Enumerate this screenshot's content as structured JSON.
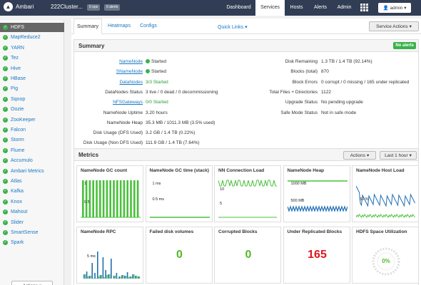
{
  "topbar": {
    "brand": "Ambari",
    "cluster": "222Cluster...",
    "ops_badge": "0 ops",
    "alerts_badge": "0 alerts",
    "nav": [
      "Dashboard",
      "Services",
      "Hosts",
      "Alerts",
      "Admin"
    ],
    "active_nav": "Services",
    "user": "admin"
  },
  "sidebar": {
    "items": [
      {
        "label": "HDFS",
        "selected": true
      },
      {
        "label": "MapReduce2"
      },
      {
        "label": "YARN"
      },
      {
        "label": "Tez"
      },
      {
        "label": "Hive"
      },
      {
        "label": "HBase"
      },
      {
        "label": "Pig"
      },
      {
        "label": "Sqoop"
      },
      {
        "label": "Oozie"
      },
      {
        "label": "ZooKeeper"
      },
      {
        "label": "Falcon"
      },
      {
        "label": "Storm"
      },
      {
        "label": "Flume"
      },
      {
        "label": "Accumulo"
      },
      {
        "label": "Ambari Metrics"
      },
      {
        "label": "Atlas"
      },
      {
        "label": "Kafka"
      },
      {
        "label": "Knox"
      },
      {
        "label": "Mahout"
      },
      {
        "label": "Slider"
      },
      {
        "label": "SmartSense"
      },
      {
        "label": "Spark"
      }
    ],
    "actions_label": "Actions"
  },
  "tabs": {
    "items": [
      "Summary",
      "Heatmaps",
      "Configs"
    ],
    "quick_links": "Quick Links",
    "service_actions": "Service Actions"
  },
  "summary": {
    "title": "Summary",
    "alert_badge": "No alerts",
    "left_rows": [
      {
        "label": "NameNode",
        "value": "Started",
        "link": true,
        "check": true
      },
      {
        "label": "SNameNode",
        "value": "Started",
        "link": true,
        "check": true
      },
      {
        "label": "DataNodes",
        "value": "3/3 Started",
        "link": true,
        "green": true
      },
      {
        "label": "DataNodes Status",
        "value": "3 live / 0 dead / 0 decommissioning"
      },
      {
        "label": "NFSGateways",
        "value": "0/0 Started",
        "link": true,
        "green": true
      },
      {
        "label": "NameNode Uptime",
        "value": "3.20 hours"
      },
      {
        "label": "NameNode Heap",
        "value": "35.3 MB / 1011.3 MB (3.5% used)"
      },
      {
        "label": "Disk Usage (DFS Used)",
        "value": "3.2 GB / 1.4 TB (0.22%)"
      },
      {
        "label": "Disk Usage (Non DFS Used)",
        "value": "111.9 GB / 1.4 TB (7.64%)"
      }
    ],
    "right_rows": [
      {
        "label": "Disk Remaining",
        "value": "1.3 TB / 1.4 TB (92.14%)"
      },
      {
        "label": "Blocks (total)",
        "value": "870"
      },
      {
        "label": "Block Errors",
        "value": "0 corrupt / 0 missing / 165 under replicated"
      },
      {
        "label": "Total Files + Directories",
        "value": "1122"
      },
      {
        "label": "Upgrade Status",
        "value": "No pending upgrade"
      },
      {
        "label": "Safe Mode Status",
        "value": "Not in safe mode"
      }
    ]
  },
  "metrics": {
    "title": "Metrics",
    "actions_label": "Actions",
    "range_label": "Last 1 hour",
    "widgets": [
      {
        "title": "NameNode GC count",
        "kind": "bars",
        "labels": [
          "1",
          "0.5"
        ]
      },
      {
        "title": "NameNode GC time (stack)",
        "kind": "flat",
        "labels": [
          "1 ms",
          "0.5 ms"
        ]
      },
      {
        "title": "NN Connection Load",
        "kind": "pulse",
        "labels": [
          "10",
          "5"
        ]
      },
      {
        "title": "NameNode Heap",
        "kind": "heap",
        "labels": [
          "1000 MB",
          "500 MB"
        ]
      },
      {
        "title": "NameNode Host Load",
        "kind": "load",
        "labels": [
          "50 %"
        ]
      },
      {
        "title": "NameNode RPC",
        "kind": "rpc",
        "labels": [
          "5 ms"
        ]
      },
      {
        "title": "Failed disk volumes",
        "kind": "number",
        "value": "0",
        "color": "#55b829"
      },
      {
        "title": "Corrupted Blocks",
        "kind": "number",
        "value": "0",
        "color": "#55b829"
      },
      {
        "title": "Under Replicated Blocks",
        "kind": "number",
        "value": "165",
        "color": "#e0161f"
      },
      {
        "title": "HDFS Space Utilization",
        "kind": "gauge",
        "value": "0%",
        "color": "#55b829"
      }
    ]
  }
}
